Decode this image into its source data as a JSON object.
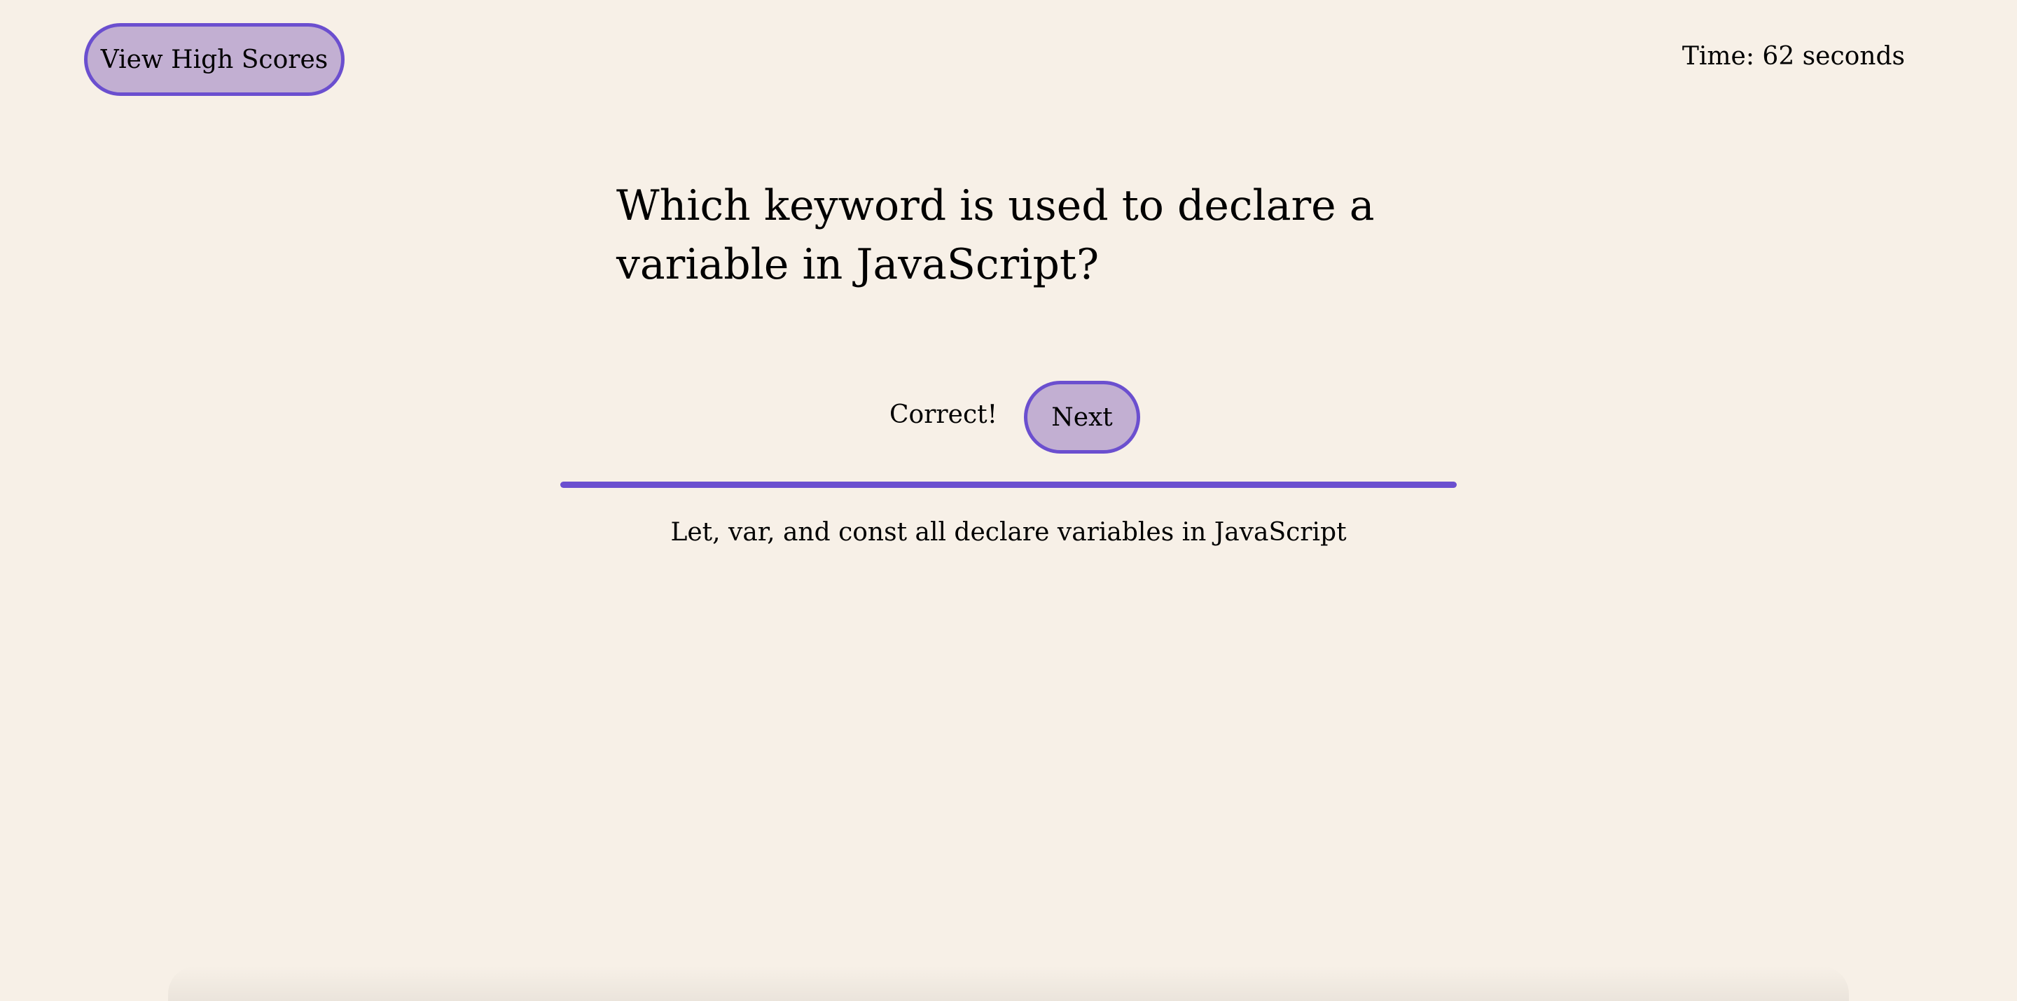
{
  "header": {
    "high_scores_label": "View High Scores",
    "timer_text": "Time: 62 seconds"
  },
  "quiz": {
    "question": "Which keyword is used to declare a variable in JavaScript?",
    "feedback": "Correct!",
    "next_label": "Next",
    "explanation": "Let, var, and const all declare variables in JavaScript"
  },
  "colors": {
    "background": "#f7f0e7",
    "button_fill": "#c2afd2",
    "accent": "#6b4fcf"
  }
}
